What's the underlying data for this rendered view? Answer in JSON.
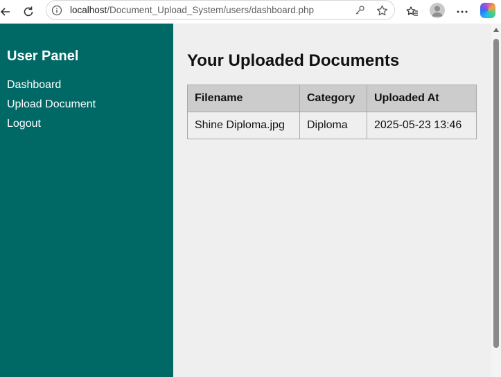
{
  "browser": {
    "url_host": "localhost",
    "url_path": "/Document_Upload_System/users/dashboard.php"
  },
  "sidebar": {
    "title": "User Panel",
    "links": [
      {
        "label": "Dashboard"
      },
      {
        "label": "Upload Document"
      },
      {
        "label": "Logout"
      }
    ]
  },
  "main": {
    "heading": "Your Uploaded Documents",
    "table": {
      "headers": [
        "Filename",
        "Category",
        "Uploaded At"
      ],
      "rows": [
        [
          "Shine Diploma.jpg",
          "Diploma",
          "2025-05-23 13:46"
        ]
      ]
    }
  },
  "colors": {
    "sidebar_bg": "#006966",
    "main_bg": "#efefef",
    "table_header_bg": "#cccccc"
  }
}
